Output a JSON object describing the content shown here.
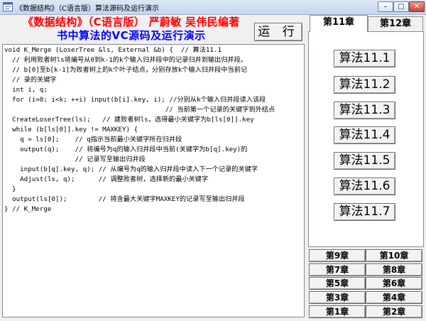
{
  "window": {
    "title": "《数据结构》（C语言版）算法源码及运行演示",
    "minimize": "–",
    "maximize": "□",
    "close": "✕"
  },
  "header": {
    "book_title": "《数据结构》（C语言版） 严蔚敏 吴伟民编著",
    "subtitle": "书中算法的VC源码及运行演示",
    "run_button": "运 行"
  },
  "tabs": [
    {
      "label": "第11章",
      "selected": true
    },
    {
      "label": "第12章",
      "selected": false
    }
  ],
  "algorithms": [
    "算法11.1",
    "算法11.2",
    "算法11.3",
    "算法11.4",
    "算法11.5",
    "算法11.6",
    "算法11.7"
  ],
  "chapters": [
    [
      "第9章",
      "第10章"
    ],
    [
      "第7章",
      "第8章"
    ],
    [
      "第5章",
      "第6章"
    ],
    [
      "第3章",
      "第4章"
    ],
    [
      "第1章",
      "第2章"
    ]
  ],
  "code": [
    "void K_Merge (LoserTree &ls, External &b) {  // 算法11.1",
    "  // 利用败者树ls将编号从0到k-1的k个输入归并段中的记录归并到输出归并段。",
    "  // b[0]至b[k-1]为败者树上的k个叶子结点，分别存放k个输入归并段中当前记",
    "  // 录的关键字",
    "  int i, q;",
    "  for (i=0; i<k; ++i) input(b[i].key, i); //分别从k个输入归并段读入该段",
    "                                         // 当前第一个记录的关键字到外结点",
    "  CreateLoserTree(ls);   // 建败者树ls，选得最小关键字为b[ls[0]].key",
    "  while (b[ls[0]].key != MAXKEY) {",
    "    q = ls[0];    // q指示当前最小关键字所在归并段",
    "    output(q);    // 将编号为q的输入归并段中当前(关键字为b[q].key)的",
    "                  // 记录写至输出归并段",
    "    input(b[q].key, q); // 从编号为q的输入归并段中读入下一个记录的关键字",
    "    Adjust(ls, q);      // 调整败者树，选择新的最小关键字",
    "  }",
    "  output(ls[0]);        // 将含最大关键字MAXKEY的记录写至输出归并段",
    "} // K_Merge"
  ]
}
